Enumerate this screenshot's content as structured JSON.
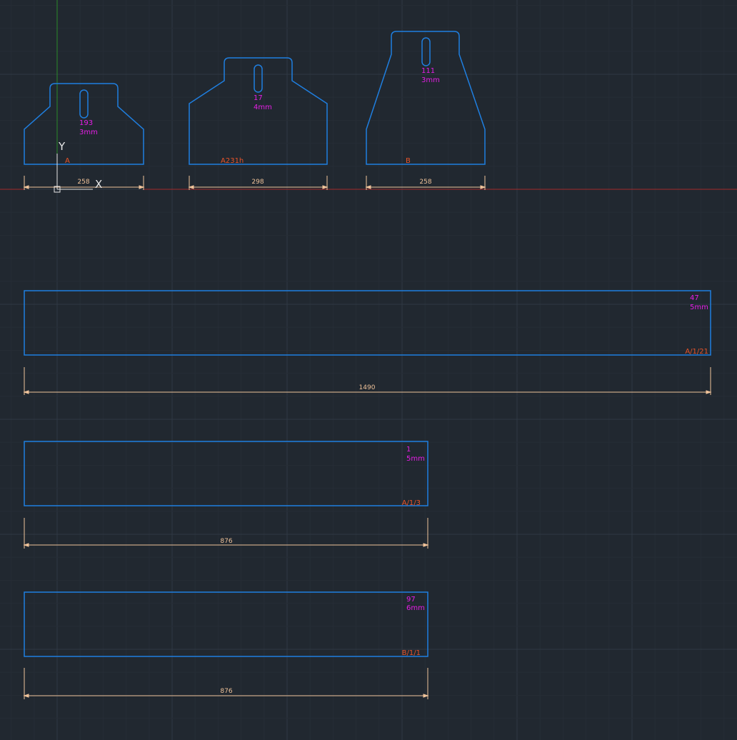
{
  "colors": {
    "background": "#212830",
    "grid_major": "#303944",
    "grid_minor": "#262d36",
    "part_outline": "#1f7fe0",
    "quantity_text": "#e61ee6",
    "part_label": "#e8542a",
    "dimension": "#f0c39a",
    "x_axis": "#a32a2a",
    "y_axis": "#2a8a2a",
    "ucs": "#e6e6e6"
  },
  "ucs": {
    "x_label": "X",
    "y_label": "Y"
  },
  "parts": [
    {
      "id": "part-a",
      "qty": "193",
      "thickness": "3mm",
      "label": "A",
      "dimension": "258"
    },
    {
      "id": "part-a231h",
      "qty": "17",
      "thickness": "4mm",
      "label": "A231h",
      "dimension": "298"
    },
    {
      "id": "part-b",
      "qty": "111",
      "thickness": "3mm",
      "label": "B",
      "dimension": "258"
    },
    {
      "id": "strip-a-1-21",
      "qty": "47",
      "thickness": "5mm",
      "label": "A/1/21",
      "dimension": "1490"
    },
    {
      "id": "strip-a-1-3",
      "qty": "1",
      "thickness": "5mm",
      "label": "A/1/3",
      "dimension": "876"
    },
    {
      "id": "strip-b-1-1",
      "qty": "97",
      "thickness": "6mm",
      "label": "B/1/1",
      "dimension": "876"
    }
  ]
}
